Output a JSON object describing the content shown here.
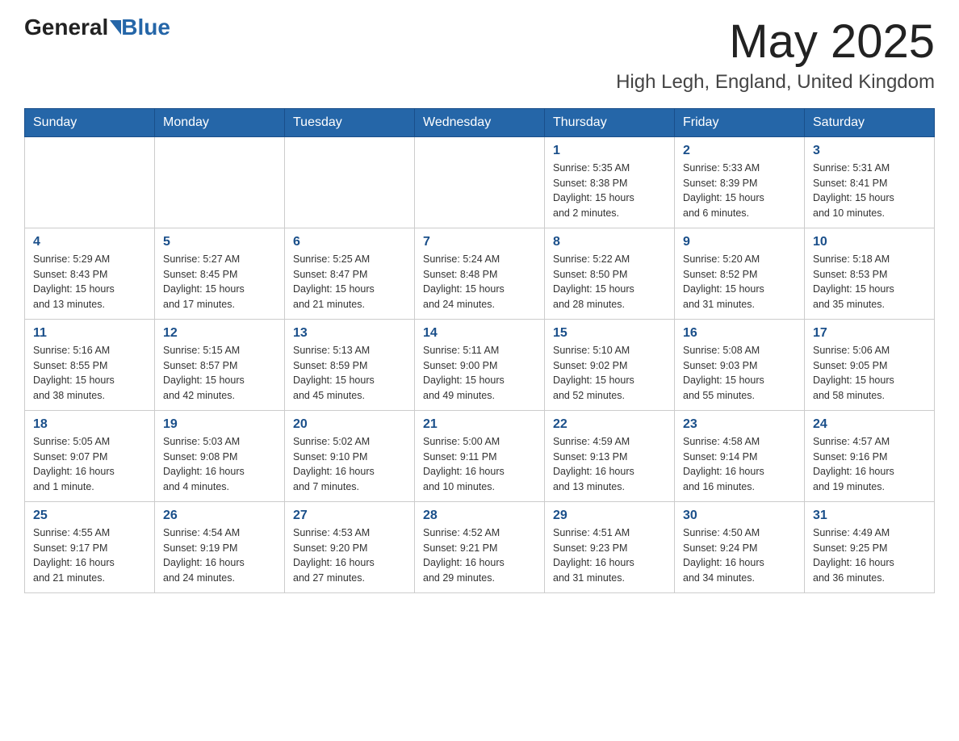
{
  "header": {
    "logo_general": "General",
    "logo_blue": "Blue",
    "month_title": "May 2025",
    "location": "High Legh, England, United Kingdom"
  },
  "days_of_week": [
    "Sunday",
    "Monday",
    "Tuesday",
    "Wednesday",
    "Thursday",
    "Friday",
    "Saturday"
  ],
  "weeks": [
    [
      {
        "day": "",
        "info": ""
      },
      {
        "day": "",
        "info": ""
      },
      {
        "day": "",
        "info": ""
      },
      {
        "day": "",
        "info": ""
      },
      {
        "day": "1",
        "info": "Sunrise: 5:35 AM\nSunset: 8:38 PM\nDaylight: 15 hours\nand 2 minutes."
      },
      {
        "day": "2",
        "info": "Sunrise: 5:33 AM\nSunset: 8:39 PM\nDaylight: 15 hours\nand 6 minutes."
      },
      {
        "day": "3",
        "info": "Sunrise: 5:31 AM\nSunset: 8:41 PM\nDaylight: 15 hours\nand 10 minutes."
      }
    ],
    [
      {
        "day": "4",
        "info": "Sunrise: 5:29 AM\nSunset: 8:43 PM\nDaylight: 15 hours\nand 13 minutes."
      },
      {
        "day": "5",
        "info": "Sunrise: 5:27 AM\nSunset: 8:45 PM\nDaylight: 15 hours\nand 17 minutes."
      },
      {
        "day": "6",
        "info": "Sunrise: 5:25 AM\nSunset: 8:47 PM\nDaylight: 15 hours\nand 21 minutes."
      },
      {
        "day": "7",
        "info": "Sunrise: 5:24 AM\nSunset: 8:48 PM\nDaylight: 15 hours\nand 24 minutes."
      },
      {
        "day": "8",
        "info": "Sunrise: 5:22 AM\nSunset: 8:50 PM\nDaylight: 15 hours\nand 28 minutes."
      },
      {
        "day": "9",
        "info": "Sunrise: 5:20 AM\nSunset: 8:52 PM\nDaylight: 15 hours\nand 31 minutes."
      },
      {
        "day": "10",
        "info": "Sunrise: 5:18 AM\nSunset: 8:53 PM\nDaylight: 15 hours\nand 35 minutes."
      }
    ],
    [
      {
        "day": "11",
        "info": "Sunrise: 5:16 AM\nSunset: 8:55 PM\nDaylight: 15 hours\nand 38 minutes."
      },
      {
        "day": "12",
        "info": "Sunrise: 5:15 AM\nSunset: 8:57 PM\nDaylight: 15 hours\nand 42 minutes."
      },
      {
        "day": "13",
        "info": "Sunrise: 5:13 AM\nSunset: 8:59 PM\nDaylight: 15 hours\nand 45 minutes."
      },
      {
        "day": "14",
        "info": "Sunrise: 5:11 AM\nSunset: 9:00 PM\nDaylight: 15 hours\nand 49 minutes."
      },
      {
        "day": "15",
        "info": "Sunrise: 5:10 AM\nSunset: 9:02 PM\nDaylight: 15 hours\nand 52 minutes."
      },
      {
        "day": "16",
        "info": "Sunrise: 5:08 AM\nSunset: 9:03 PM\nDaylight: 15 hours\nand 55 minutes."
      },
      {
        "day": "17",
        "info": "Sunrise: 5:06 AM\nSunset: 9:05 PM\nDaylight: 15 hours\nand 58 minutes."
      }
    ],
    [
      {
        "day": "18",
        "info": "Sunrise: 5:05 AM\nSunset: 9:07 PM\nDaylight: 16 hours\nand 1 minute."
      },
      {
        "day": "19",
        "info": "Sunrise: 5:03 AM\nSunset: 9:08 PM\nDaylight: 16 hours\nand 4 minutes."
      },
      {
        "day": "20",
        "info": "Sunrise: 5:02 AM\nSunset: 9:10 PM\nDaylight: 16 hours\nand 7 minutes."
      },
      {
        "day": "21",
        "info": "Sunrise: 5:00 AM\nSunset: 9:11 PM\nDaylight: 16 hours\nand 10 minutes."
      },
      {
        "day": "22",
        "info": "Sunrise: 4:59 AM\nSunset: 9:13 PM\nDaylight: 16 hours\nand 13 minutes."
      },
      {
        "day": "23",
        "info": "Sunrise: 4:58 AM\nSunset: 9:14 PM\nDaylight: 16 hours\nand 16 minutes."
      },
      {
        "day": "24",
        "info": "Sunrise: 4:57 AM\nSunset: 9:16 PM\nDaylight: 16 hours\nand 19 minutes."
      }
    ],
    [
      {
        "day": "25",
        "info": "Sunrise: 4:55 AM\nSunset: 9:17 PM\nDaylight: 16 hours\nand 21 minutes."
      },
      {
        "day": "26",
        "info": "Sunrise: 4:54 AM\nSunset: 9:19 PM\nDaylight: 16 hours\nand 24 minutes."
      },
      {
        "day": "27",
        "info": "Sunrise: 4:53 AM\nSunset: 9:20 PM\nDaylight: 16 hours\nand 27 minutes."
      },
      {
        "day": "28",
        "info": "Sunrise: 4:52 AM\nSunset: 9:21 PM\nDaylight: 16 hours\nand 29 minutes."
      },
      {
        "day": "29",
        "info": "Sunrise: 4:51 AM\nSunset: 9:23 PM\nDaylight: 16 hours\nand 31 minutes."
      },
      {
        "day": "30",
        "info": "Sunrise: 4:50 AM\nSunset: 9:24 PM\nDaylight: 16 hours\nand 34 minutes."
      },
      {
        "day": "31",
        "info": "Sunrise: 4:49 AM\nSunset: 9:25 PM\nDaylight: 16 hours\nand 36 minutes."
      }
    ]
  ]
}
